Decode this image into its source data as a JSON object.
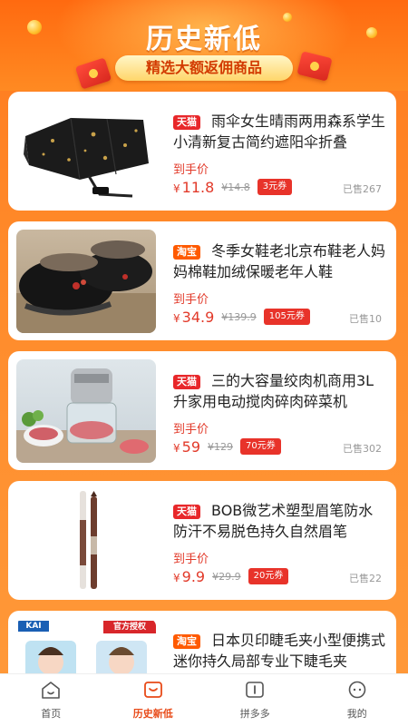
{
  "header": {
    "title": "历史新低",
    "subtitle": "精选大额返佣商品"
  },
  "price_label_text": "到手价",
  "currency": "¥",
  "products": [
    {
      "platform": "天猫",
      "title": "雨伞女生晴雨两用森系学生小清新复古简约遮阳伞折叠",
      "price": "11.8",
      "original_price": "¥14.8",
      "coupon": "3元券",
      "sold": "已售267"
    },
    {
      "platform": "淘宝",
      "title": "冬季女鞋老北京布鞋老人妈妈棉鞋加绒保暖老年人鞋",
      "price": "34.9",
      "original_price": "¥139.9",
      "coupon": "105元券",
      "sold": "已售10"
    },
    {
      "platform": "天猫",
      "title": "三的大容量绞肉机商用3L升家用电动搅肉碎肉碎菜机",
      "price": "59",
      "original_price": "¥129",
      "coupon": "70元券",
      "sold": "已售302"
    },
    {
      "platform": "天猫",
      "title": "BOB微艺术塑型眉笔防水防汗不易脱色持久自然眉笔",
      "price": "9.9",
      "original_price": "¥29.9",
      "coupon": "20元券",
      "sold": "已售22"
    },
    {
      "platform": "淘宝",
      "title": "日本贝印睫毛夹小型便携式迷你持久局部专业下睫毛夹",
      "price": "",
      "original_price": "",
      "coupon": "",
      "sold": ""
    }
  ],
  "thumb_labels": {
    "kai_logo": "KAI",
    "official_badge": "官方授权"
  },
  "tabs": [
    {
      "label": "首页",
      "icon": "home-icon",
      "active": false
    },
    {
      "label": "历史新低",
      "icon": "inbox-icon",
      "active": true
    },
    {
      "label": "拼多多",
      "icon": "book-icon",
      "active": false
    },
    {
      "label": "我的",
      "icon": "chat-face-icon",
      "active": false
    }
  ],
  "colors": {
    "accent": "#e84a18",
    "price": "#e23a2a",
    "tmall": "#e8272a",
    "taobao": "#ff5a00",
    "background": "#ff8a2a"
  }
}
